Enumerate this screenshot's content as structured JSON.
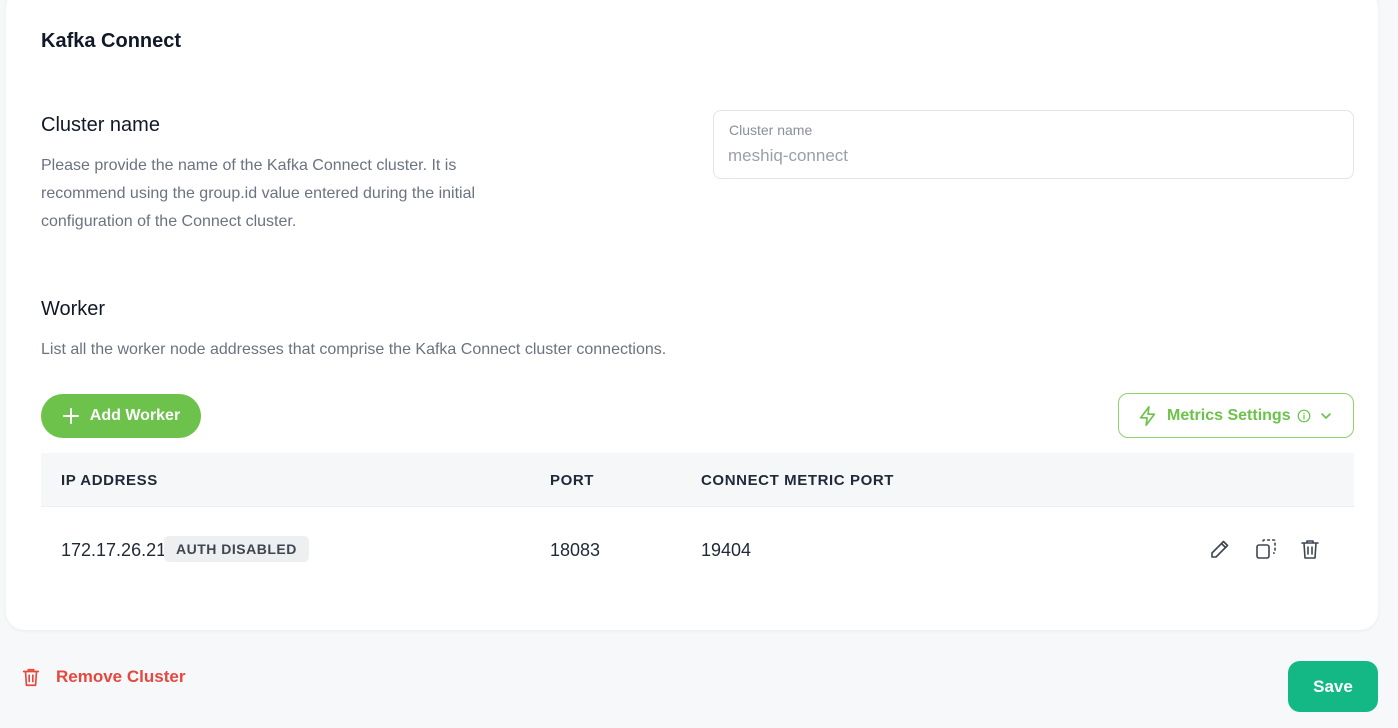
{
  "card": {
    "title": "Kafka Connect"
  },
  "cluster": {
    "heading": "Cluster name",
    "description_lines": [
      "Please provide the name of the Kafka Connect cluster. It is",
      "recommend using the group.id value entered during the initial",
      "configuration of the Connect cluster."
    ],
    "field_label": "Cluster name",
    "field_value": "meshiq-connect"
  },
  "worker": {
    "heading": "Worker",
    "description": "List all the worker node addresses that comprise the Kafka Connect cluster connections.",
    "add_button_label": "Add Worker",
    "metrics_button_label": "Metrics Settings"
  },
  "table": {
    "columns": [
      "IP ADDRESS",
      "PORT",
      "CONNECT METRIC PORT"
    ],
    "rows": [
      {
        "ip": "172.17.26.21",
        "badge": "AUTH DISABLED",
        "port": "18083",
        "metric_port": "19404"
      }
    ]
  },
  "footer": {
    "remove_label": "Remove Cluster",
    "save_label": "Save"
  },
  "colors": {
    "accent_green": "#6cc24a",
    "save_green": "#14b884",
    "danger_red": "#e5483f"
  },
  "icons": [
    "plus-icon",
    "bolt-icon",
    "info-icon",
    "chevron-down-icon",
    "pencil-icon",
    "copy-icon",
    "trash-icon"
  ]
}
